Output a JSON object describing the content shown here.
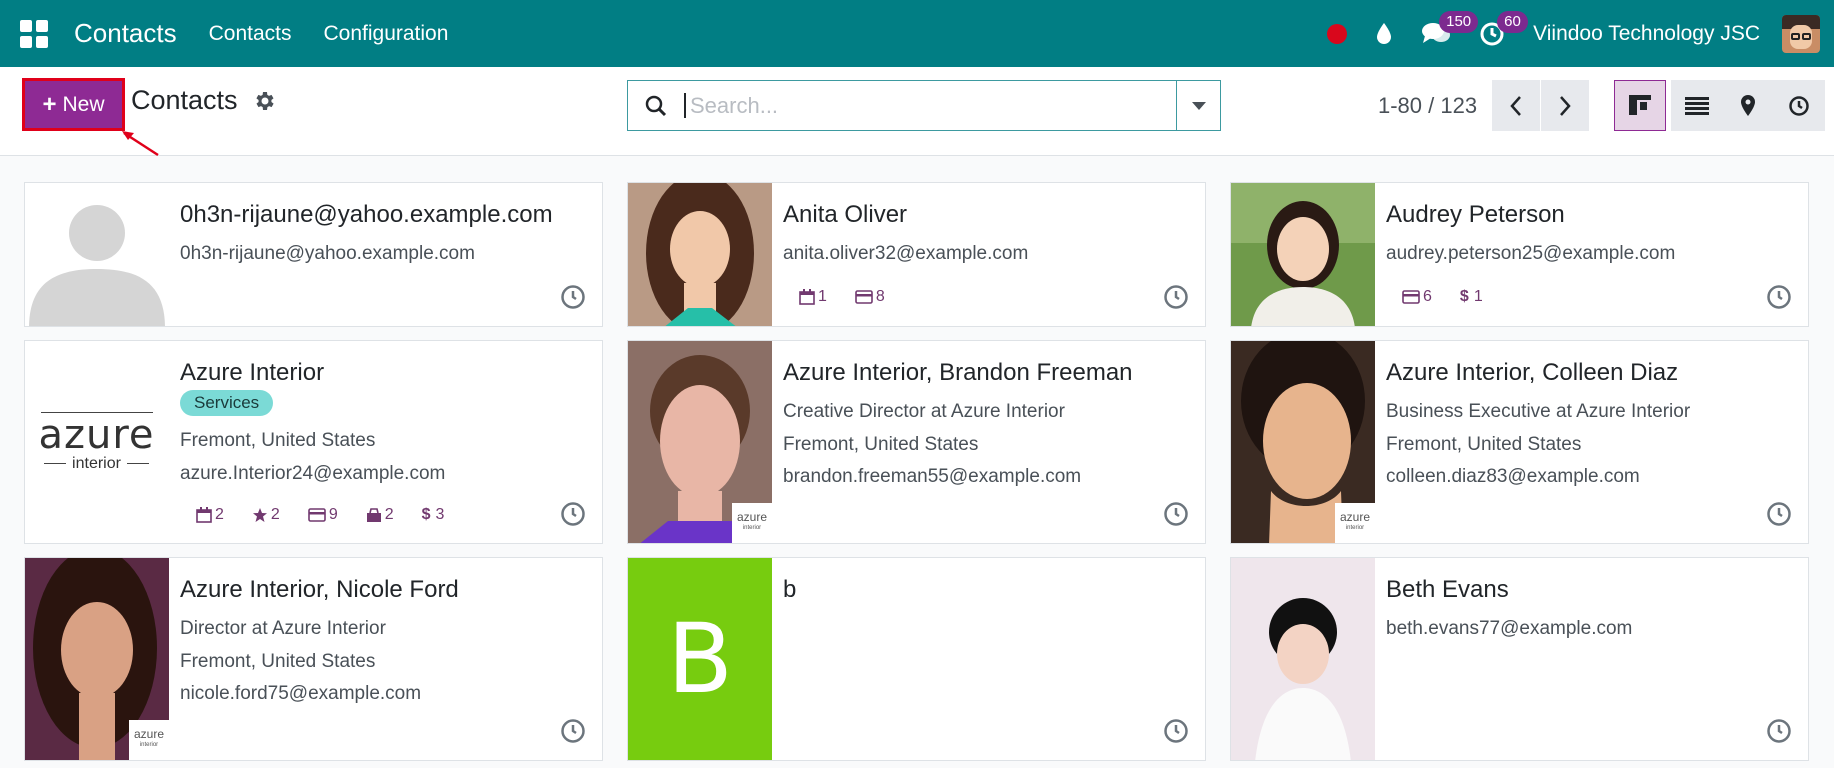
{
  "topbar": {
    "brand": "Contacts",
    "nav": [
      "Contacts",
      "Configuration"
    ],
    "messages_count": "150",
    "activities_count": "60",
    "company": "Viindoo Technology JSC"
  },
  "control": {
    "new_label": "New",
    "breadcrumb": "Contacts",
    "search_placeholder": "Search...",
    "pager": "1-80 / 123"
  },
  "cards": [
    {
      "name": "0h3n-rijaune@yahoo.example.com",
      "lines": [
        "0h3n-rijaune@yahoo.example.com"
      ],
      "avatar": "placeholder"
    },
    {
      "name": "Anita Oliver",
      "lines": [
        "anita.oliver32@example.com"
      ],
      "stats": {
        "meetings": "1",
        "invoices": "8"
      },
      "avatar": "photo"
    },
    {
      "name": "Audrey Peterson",
      "lines": [
        "audrey.peterson25@example.com"
      ],
      "stats": {
        "invoices": "6",
        "amount": "1"
      },
      "avatar": "photo"
    },
    {
      "name": "Azure Interior",
      "tag": "Services",
      "lines": [
        "Fremont, United States",
        "azure.Interior24@example.com"
      ],
      "stats": {
        "meetings": "2",
        "favorites": "2",
        "invoices": "9",
        "purchases": "2",
        "amount": "3"
      },
      "avatar": "azure-logo",
      "logo_text": "azure",
      "logo_sub": "interior"
    },
    {
      "name": "Azure Interior, Brandon Freeman",
      "lines": [
        "Creative Director at Azure Interior",
        "Fremont, United States",
        "brandon.freeman55@example.com"
      ],
      "avatar": "photo"
    },
    {
      "name": "Azure Interior, Colleen Diaz",
      "lines": [
        "Business Executive at Azure Interior",
        "Fremont, United States",
        "colleen.diaz83@example.com"
      ],
      "avatar": "photo"
    },
    {
      "name": "Azure Interior, Nicole Ford",
      "lines": [
        "Director at Azure Interior",
        "Fremont, United States",
        "nicole.ford75@example.com"
      ],
      "avatar": "photo"
    },
    {
      "name": "b",
      "lines": [],
      "avatar": "letter",
      "letter": "B",
      "letter_color": "#77cc0f"
    },
    {
      "name": "Beth Evans",
      "lines": [
        "beth.evans77@example.com"
      ],
      "avatar": "photo"
    }
  ],
  "colors": {
    "topbar": "#017e84",
    "primary": "#8e2a94",
    "highlight": "#e0001a",
    "tag": "#7bdad6"
  }
}
